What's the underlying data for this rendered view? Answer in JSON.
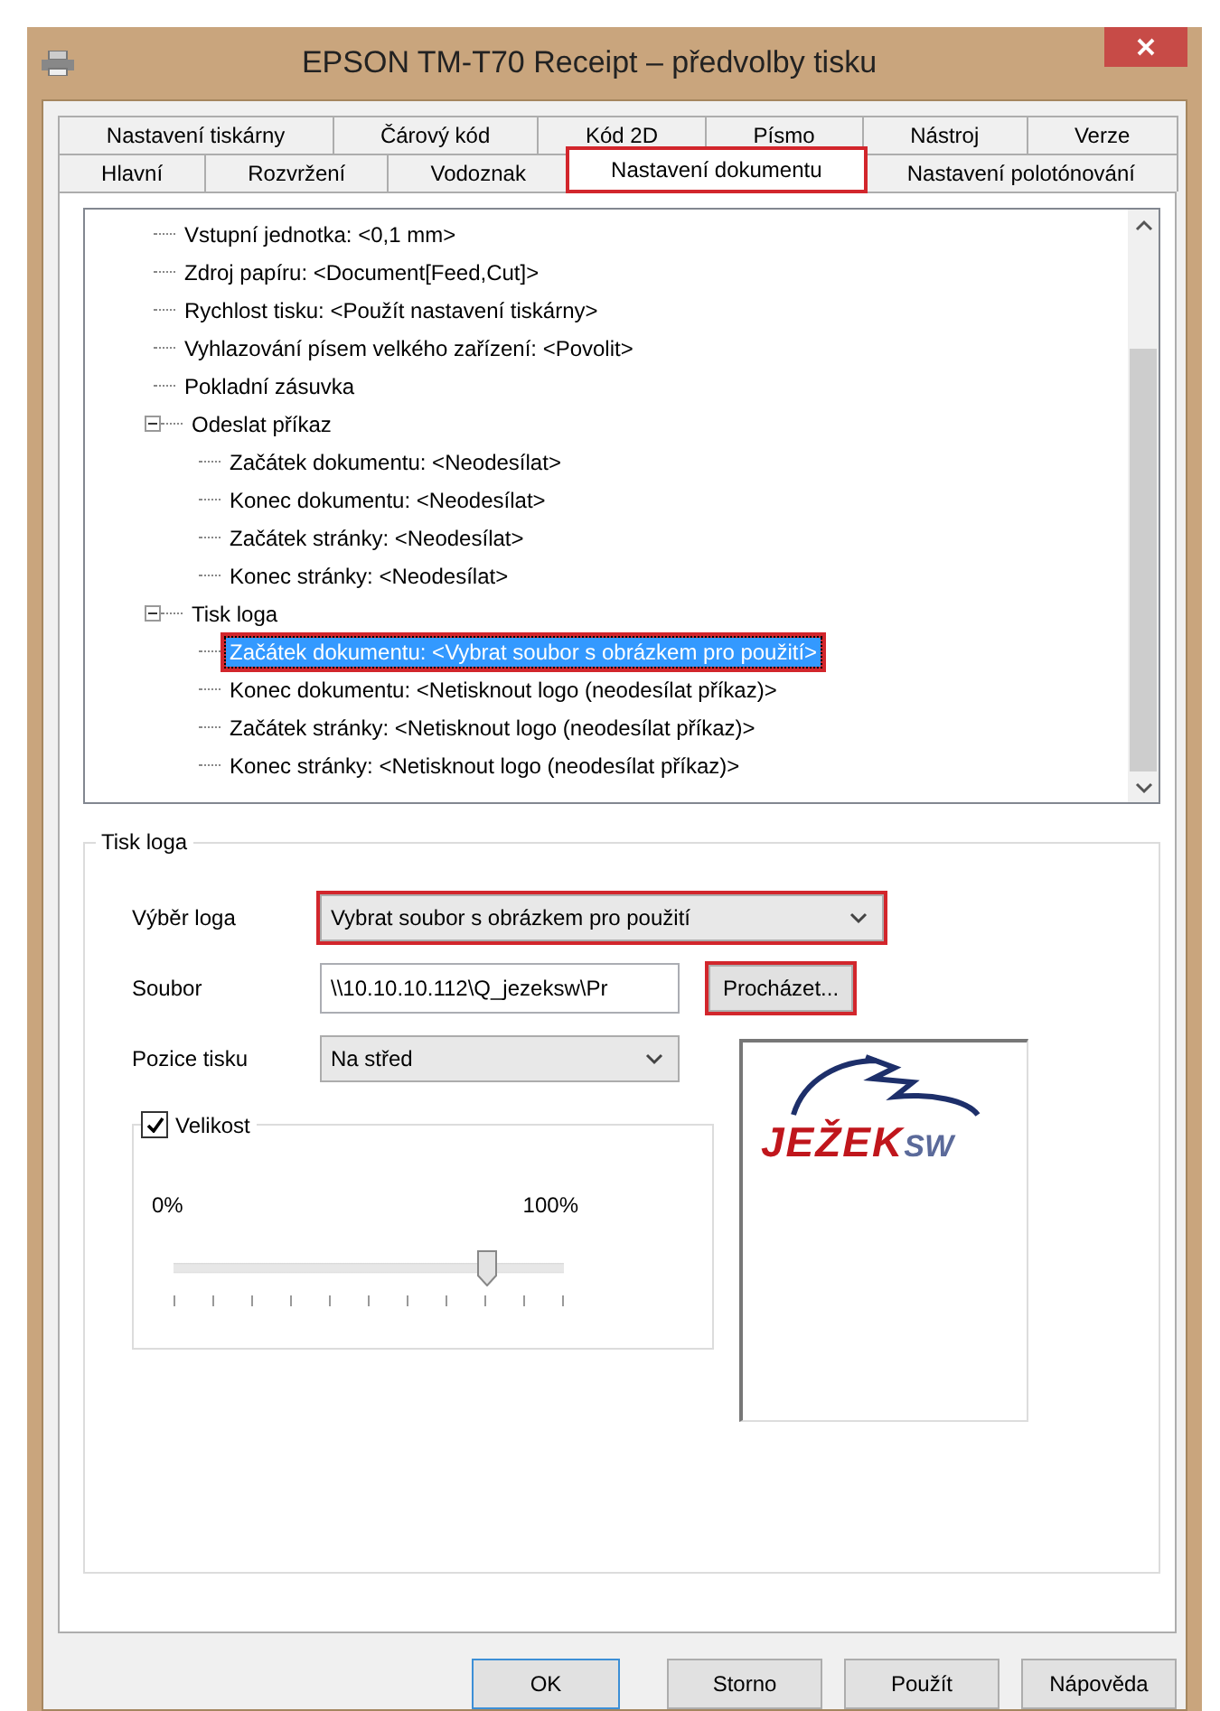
{
  "window": {
    "title": "EPSON TM-T70 Receipt – předvolby tisku"
  },
  "tab_rows": [
    {
      "tabs": [
        {
          "label": "Nastavení tiskárny",
          "selected": false,
          "highlighted": false
        },
        {
          "label": "Čárový kód",
          "selected": false,
          "highlighted": false
        },
        {
          "label": "Kód 2D",
          "selected": false,
          "highlighted": false
        },
        {
          "label": "Písmo",
          "selected": false,
          "highlighted": false
        },
        {
          "label": "Nástroj",
          "selected": false,
          "highlighted": false
        },
        {
          "label": "Verze",
          "selected": false,
          "highlighted": false
        }
      ]
    },
    {
      "tabs": [
        {
          "label": "Hlavní",
          "selected": false,
          "highlighted": false
        },
        {
          "label": "Rozvržení",
          "selected": false,
          "highlighted": false
        },
        {
          "label": "Vodoznak",
          "selected": false,
          "highlighted": false
        },
        {
          "label": "Nastavení dokumentu",
          "selected": true,
          "highlighted": true
        },
        {
          "label": "Nastavení polotónování",
          "selected": false,
          "highlighted": false
        }
      ]
    }
  ],
  "tree": {
    "items": [
      {
        "label": "Vstupní jednotka: <0,1 mm>",
        "selected": false,
        "highlighted": false
      },
      {
        "label": "Zdroj papíru: <Document[Feed,Cut]>",
        "selected": false,
        "highlighted": false
      },
      {
        "label": "Rychlost tisku: <Použít nastavení tiskárny>",
        "selected": false,
        "highlighted": false
      },
      {
        "label": "Vyhlazování písem velkého zařízení: <Povolit>",
        "selected": false,
        "highlighted": false
      },
      {
        "label": "Pokladní zásuvka",
        "selected": false,
        "highlighted": false
      },
      {
        "label": "Odeslat příkaz",
        "selected": false,
        "highlighted": false,
        "expanded": true,
        "children": [
          {
            "label": "Začátek dokumentu: <Neodesílat>",
            "selected": false,
            "highlighted": false
          },
          {
            "label": "Konec dokumentu: <Neodesílat>",
            "selected": false,
            "highlighted": false
          },
          {
            "label": "Začátek stránky: <Neodesílat>",
            "selected": false,
            "highlighted": false
          },
          {
            "label": "Konec stránky: <Neodesílat>",
            "selected": false,
            "highlighted": false
          }
        ]
      },
      {
        "label": "Tisk loga",
        "selected": false,
        "highlighted": false,
        "expanded": true,
        "children": [
          {
            "label": "Začátek dokumentu: <Vybrat soubor s obrázkem pro použití>",
            "selected": true,
            "highlighted": true
          },
          {
            "label": "Konec dokumentu: <Netisknout logo (neodesílat příkaz)>",
            "selected": false,
            "highlighted": false
          },
          {
            "label": "Začátek stránky: <Netisknout logo (neodesílat příkaz)>",
            "selected": false,
            "highlighted": false
          },
          {
            "label": "Konec stránky: <Netisknout logo (neodesílat příkaz)>",
            "selected": false,
            "highlighted": false
          }
        ]
      }
    ]
  },
  "group": {
    "title": "Tisk loga",
    "logo_select": {
      "label": "Výběr loga",
      "value": "Vybrat soubor s obrázkem pro použití",
      "highlighted": true
    },
    "file": {
      "label": "Soubor",
      "value": "\\\\10.10.10.112\\Q_jezeksw\\Pr",
      "browse": "Procházet...",
      "browse_highlighted": true
    },
    "position": {
      "label": "Pozice tisku",
      "value": "Na střed",
      "highlighted": false
    },
    "size": {
      "label": "Velikost",
      "checked": true,
      "min": "0%",
      "max": "100%",
      "level": 0.8
    },
    "preview": {
      "logo_name": "JEŽEK",
      "logo_suffix": "SW"
    }
  },
  "buttons": [
    {
      "label": "OK",
      "default": true
    },
    {
      "label": "Storno",
      "default": false
    },
    {
      "label": "Použít",
      "default": false
    },
    {
      "label": "Nápověda",
      "default": false
    }
  ]
}
